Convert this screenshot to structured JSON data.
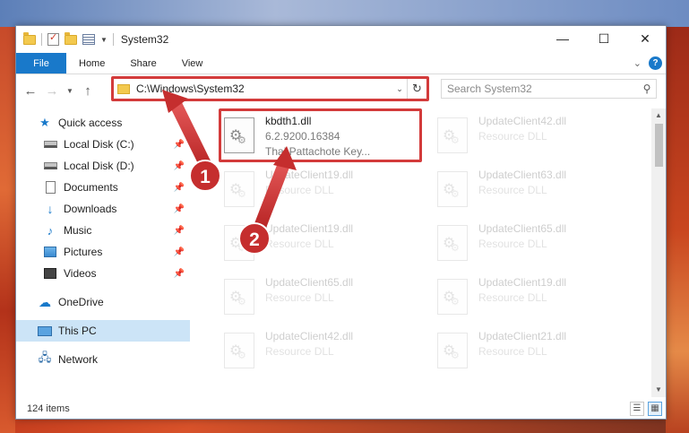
{
  "window": {
    "title": "System32",
    "controls": {
      "minimize": "—",
      "maximize": "☐",
      "close": "✕"
    }
  },
  "ribbon": {
    "file_tab": "File",
    "tabs": [
      "Home",
      "Share",
      "View"
    ],
    "help": "?"
  },
  "address": {
    "path": "C:\\Windows\\System32",
    "refresh_icon": "↻",
    "search_placeholder": "Search System32"
  },
  "sidebar": {
    "quick_access": "Quick access",
    "items": [
      {
        "label": "Local Disk (C:)",
        "icon": "drive-icon",
        "pinned": true
      },
      {
        "label": "Local Disk (D:)",
        "icon": "drive-icon",
        "pinned": true
      },
      {
        "label": "Documents",
        "icon": "documents-icon",
        "pinned": true
      },
      {
        "label": "Downloads",
        "icon": "downloads-icon",
        "pinned": true
      },
      {
        "label": "Music",
        "icon": "music-icon",
        "pinned": true
      },
      {
        "label": "Pictures",
        "icon": "pictures-icon",
        "pinned": true
      },
      {
        "label": "Videos",
        "icon": "videos-icon",
        "pinned": true
      }
    ],
    "onedrive": "OneDrive",
    "this_pc": "This PC",
    "network": "Network"
  },
  "files": {
    "highlighted": {
      "name": "kbdth1.dll",
      "version": "6.2.9200.16384",
      "description": "Thai Pattachote Key..."
    },
    "left_column": [
      {
        "name": "UpdateClient19.dll",
        "type": "Resource DLL"
      },
      {
        "name": "UpdateClient19.dll",
        "type": "Resource DLL"
      },
      {
        "name": "UpdateClient65.dll",
        "type": "Resource DLL"
      },
      {
        "name": "UpdateClient42.dll",
        "type": "Resource DLL"
      }
    ],
    "right_column": [
      {
        "name": "UpdateClient42.dll",
        "type": "Resource DLL"
      },
      {
        "name": "UpdateClient63.dll",
        "type": "Resource DLL"
      },
      {
        "name": "UpdateClient65.dll",
        "type": "Resource DLL"
      },
      {
        "name": "UpdateClient19.dll",
        "type": "Resource DLL"
      },
      {
        "name": "UpdateClient21.dll",
        "type": "Resource DLL"
      }
    ]
  },
  "status": {
    "item_count": "124 items"
  },
  "annotations": {
    "step1": "1",
    "step2": "2",
    "color": "#d33b3b"
  },
  "colors": {
    "accent": "#1979ca",
    "selection": "#cce4f7",
    "highlight": "#d33b3b"
  }
}
